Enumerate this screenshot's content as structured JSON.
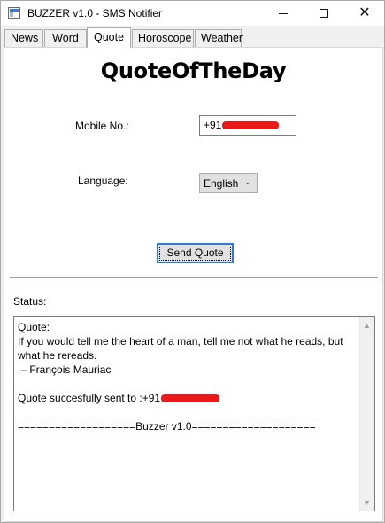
{
  "window": {
    "title": "BUZZER v1.0 - SMS Notifier",
    "icons": {
      "app": "app-window-icon",
      "minimize": "minimize-icon",
      "maximize": "maximize-icon",
      "close": "close-icon"
    }
  },
  "tabs": [
    {
      "label": "News",
      "selected": false
    },
    {
      "label": "Word",
      "selected": false
    },
    {
      "label": "Quote",
      "selected": true
    },
    {
      "label": "Horoscope",
      "selected": false
    },
    {
      "label": "Weather",
      "selected": false
    }
  ],
  "quote_tab": {
    "heading": "QuoteOfTheDay",
    "mobile": {
      "label": "Mobile No.:",
      "value_prefix": "+91"
    },
    "language": {
      "label": "Language:",
      "selected": "English"
    },
    "send_button": "Send Quote",
    "status": {
      "label": "Status:",
      "lines": [
        "Quote:",
        "If you would tell me the heart of a man, tell me not what he reads, but what he rereads.",
        " – François Mauriac",
        "",
        "Quote succesfully sent to :+91",
        "",
        "===================Buzzer v1.0===================="
      ]
    }
  },
  "colors": {
    "accent": "#2f7ad4",
    "redaction": "#ea1a1a",
    "window_bg": "#f0f0f0"
  }
}
